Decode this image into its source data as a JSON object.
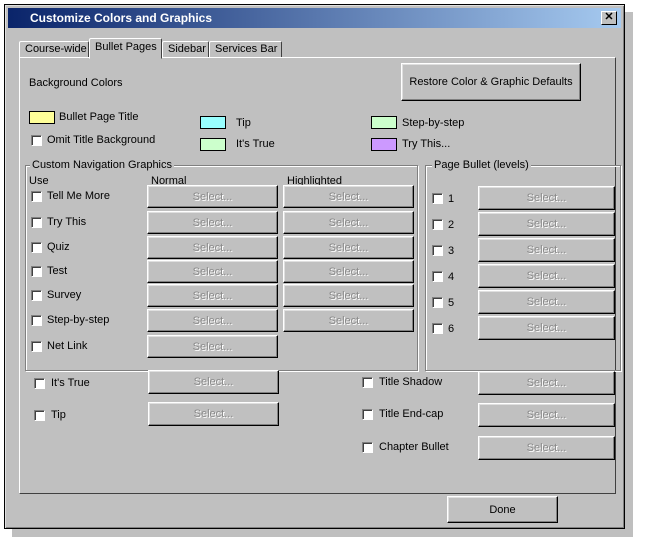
{
  "window": {
    "title": "Customize Colors and Graphics",
    "close_label": "✕"
  },
  "tabs": [
    "Course-wide",
    "Bullet Pages",
    "Sidebar",
    "Services Bar"
  ],
  "background_colors": {
    "heading": "Background Colors",
    "restore_button": "Restore Color & Graphic Defaults",
    "items": [
      {
        "label": "Bullet Page Title",
        "color": "#ffff99"
      },
      {
        "label": "Tip",
        "color": "#99ffff"
      },
      {
        "label": "It's True",
        "color": "#ccffcc"
      },
      {
        "label": "Step-by-step",
        "color": "#ccffcc"
      },
      {
        "label": "Try This...",
        "color": "#cc99ff"
      }
    ],
    "omit_title_background": "Omit Title Background"
  },
  "custom_nav": {
    "heading": "Custom Navigation Graphics",
    "col_use": "Use",
    "col_normal": "Normal",
    "col_highlighted": "Highlighted",
    "items": [
      "Tell Me More",
      "Try This",
      "Quiz",
      "Test",
      "Survey",
      "Step-by-step",
      "Net Link"
    ]
  },
  "page_bullet": {
    "heading": "Page Bullet (levels)",
    "levels": [
      "1",
      "2",
      "3",
      "4",
      "5",
      "6"
    ]
  },
  "extras_left": [
    "It's True",
    "Tip"
  ],
  "extras_right": [
    "Title Shadow",
    "Title End-cap",
    "Chapter Bullet"
  ],
  "select_label": "Select...",
  "done_button": "Done"
}
